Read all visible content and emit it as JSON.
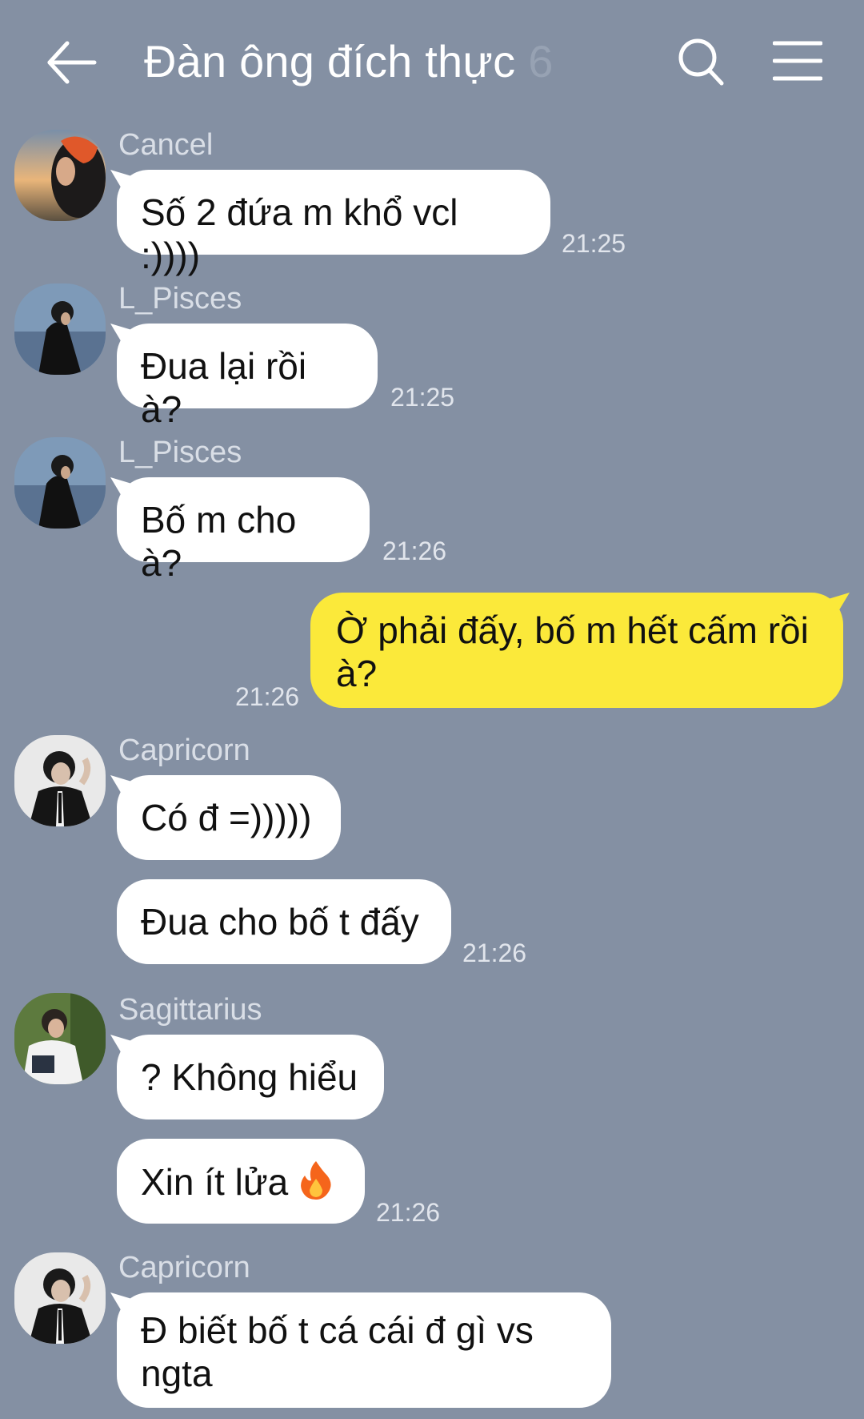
{
  "header": {
    "title": "Đàn ông đích thực",
    "member_count": "6",
    "icons": {
      "back": "arrow-left-icon",
      "search": "search-icon",
      "menu": "hamburger-menu-icon"
    }
  },
  "colors": {
    "background": "#8490a3",
    "incoming_bubble": "#ffffff",
    "outgoing_bubble": "#fbe93a"
  },
  "messages": [
    {
      "sender": "Cancel",
      "text": "Số 2 đứa m khổ vcl :))))",
      "time": "21:25"
    },
    {
      "sender": "L_Pisces",
      "text": "Đua lại rồi à?",
      "time": "21:25"
    },
    {
      "sender": "L_Pisces",
      "text": "Bố m cho à?",
      "time": "21:26"
    },
    {
      "sender": "me",
      "text": "Ờ phải đấy, bố m hết cấm rồi à?",
      "time": "21:26"
    },
    {
      "sender": "Capricorn",
      "text": "Có đ =)))))",
      "time": ""
    },
    {
      "sender": "Capricorn",
      "text": "Đua cho bố t đấy",
      "time": "21:26"
    },
    {
      "sender": "Sagittarius",
      "text": "? Không hiểu",
      "time": ""
    },
    {
      "sender": "Sagittarius",
      "text": "Xin ít lửa",
      "emoji": "fire-emoji",
      "time": "21:26"
    },
    {
      "sender": "Capricorn",
      "text": "Đ biết bố t cá cái đ gì vs ngta",
      "time": ""
    }
  ]
}
